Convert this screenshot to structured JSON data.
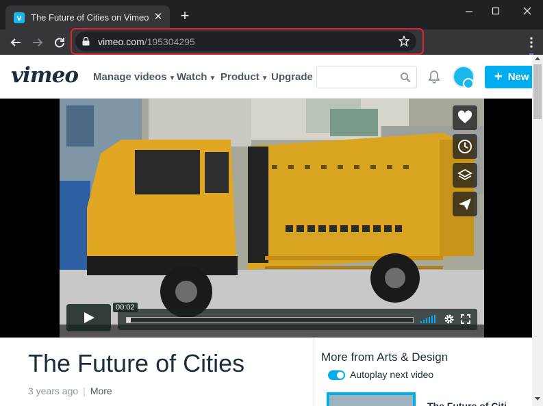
{
  "browser": {
    "tab_title": "The Future of Cities on Vimeo",
    "tab_favicon_letter": "v",
    "url_domain": "vimeo.com",
    "url_path": "/195304295"
  },
  "header": {
    "logo": "vimeo",
    "nav": [
      {
        "label": "Manage videos",
        "has_caret": true
      },
      {
        "label": "Watch",
        "has_caret": true
      },
      {
        "label": "Product",
        "has_caret": true
      },
      {
        "label": "Upgrade",
        "has_caret": false
      }
    ],
    "search_placeholder": "",
    "new_button": "New",
    "caret": "⌄"
  },
  "player": {
    "timecode": "00:02",
    "played_fraction": 0.015,
    "sidebar_icons": [
      "heart-icon",
      "clock-icon",
      "layers-icon",
      "send-icon"
    ]
  },
  "video": {
    "title": "The Future of Cities",
    "age": "3 years ago",
    "separator": "|",
    "more_label": "More"
  },
  "sidebar": {
    "heading": "More from Arts & Design",
    "autoplay_label": "Autoplay next video",
    "autoplay_on": true,
    "next_title": "The Future of Citi"
  },
  "colors": {
    "accent": "#00adef",
    "highlight": "#e0242b",
    "text_dark": "#1a2e3b"
  }
}
